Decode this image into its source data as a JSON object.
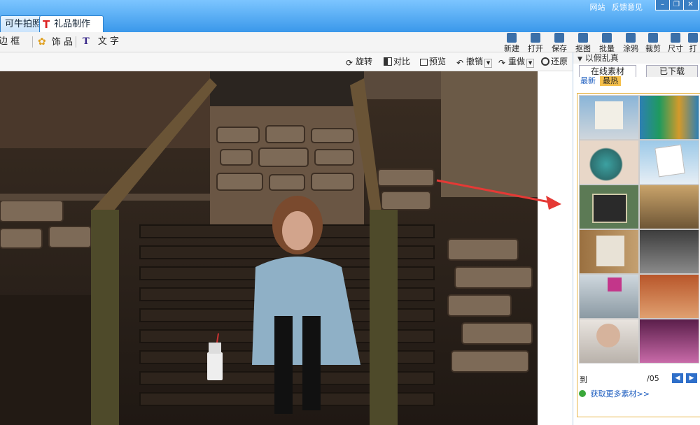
{
  "titlebar": {
    "tabs": [
      {
        "label": "可牛拍照"
      },
      {
        "label": "礼品制作"
      }
    ],
    "links": [
      "网站",
      "反馈意见"
    ]
  },
  "toolbar": {
    "left": [
      {
        "label": "边 框"
      },
      {
        "label": "饰 品"
      },
      {
        "label": "文 字"
      }
    ],
    "right": [
      {
        "label": "新建"
      },
      {
        "label": "打开"
      },
      {
        "label": "保存"
      },
      {
        "label": "抠图"
      },
      {
        "label": "批量"
      },
      {
        "label": "涂鸦"
      },
      {
        "label": "裁剪"
      },
      {
        "label": "尺寸"
      },
      {
        "label": "打"
      }
    ]
  },
  "subbar": {
    "items": [
      {
        "label": "旋转"
      },
      {
        "label": "对比"
      },
      {
        "label": "预览"
      },
      {
        "label": "撤销"
      },
      {
        "label": "重做"
      },
      {
        "label": "还原"
      }
    ]
  },
  "panel": {
    "header": "以假乱真",
    "tabs": [
      {
        "label": "在线素材"
      },
      {
        "label": "已下载"
      }
    ],
    "subtabs": [
      {
        "label": "最新"
      },
      {
        "label": "最热"
      }
    ],
    "pager": {
      "left_label": "到",
      "page_text": "/05"
    },
    "more_link": "获取更多素材>>"
  },
  "colors": {
    "titlebar": "#3a98ea",
    "accent_border": "#e8b64a",
    "arrow": "#e53935"
  }
}
